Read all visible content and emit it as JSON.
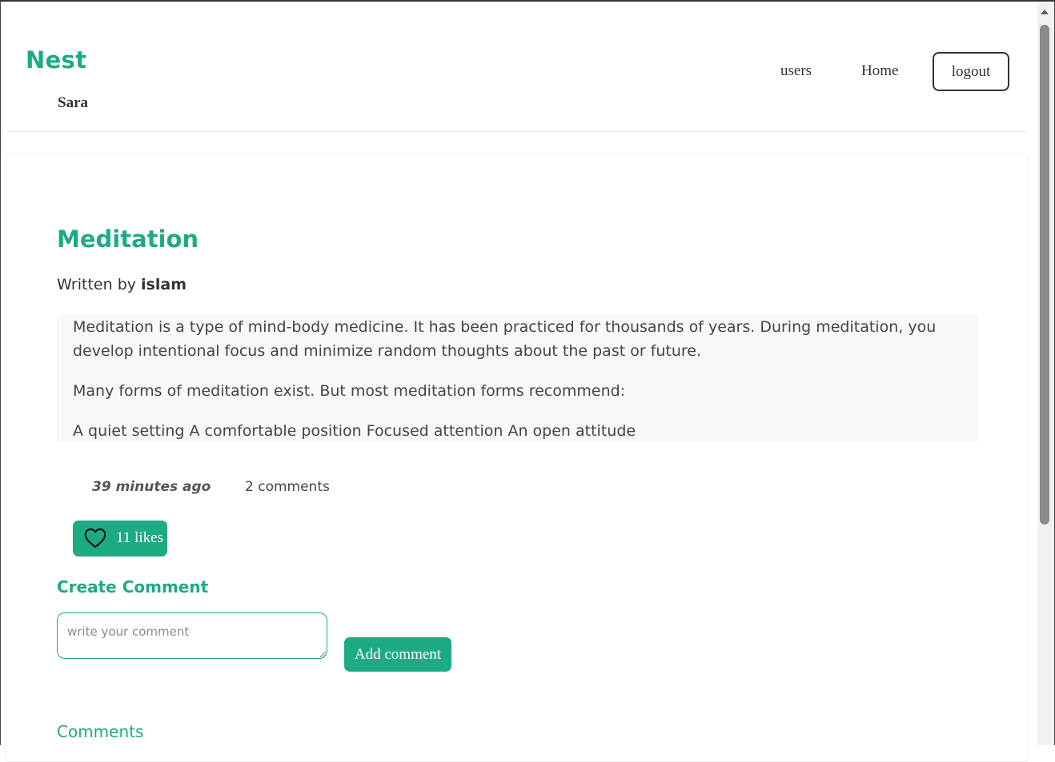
{
  "nav": {
    "brand": "Nest",
    "username": "Sara",
    "links": [
      "users",
      "Home"
    ],
    "logout_label": "logout"
  },
  "post": {
    "title": "Meditation",
    "author_prefix": "Written by",
    "author": "islam",
    "paragraphs": [
      "Meditation is a type of mind-body medicine. It has been practiced for thousands of years. During meditation, you develop intentional focus and minimize random thoughts about the past or future.",
      "Many forms of meditation exist. But most meditation forms recommend:",
      "A quiet setting A comfortable position Focused attention An open attitude"
    ],
    "time_ago": "39 minutes ago",
    "comments_count": "2 comments",
    "likes_label": "11 likes"
  },
  "create_comment": {
    "heading": "Create Comment",
    "placeholder": "write your comment",
    "button_label": "Add comment"
  },
  "comments": {
    "heading": "Comments"
  },
  "colors": {
    "accent": "#1dab84",
    "text": "#333333",
    "body_box_bg": "#f8f8f8"
  },
  "icons": {
    "likes": "heart-icon"
  }
}
